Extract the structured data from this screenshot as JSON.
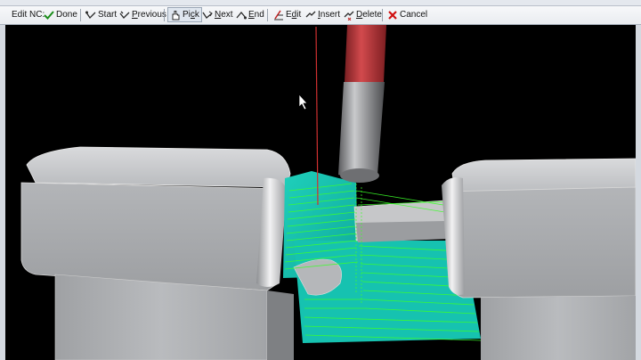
{
  "toolbar": {
    "title": "Edit NC:",
    "buttons": {
      "done": "Done",
      "start": "Start",
      "previous": "Previous",
      "pick": "Pick",
      "next": "Next",
      "end": "End",
      "edit": "Edit",
      "insert": "Insert",
      "delete": "Delete",
      "cancel": "Cancel"
    }
  },
  "colors": {
    "toolbar_bg": "#eceff3",
    "viewport_bg": "#000000",
    "part_gray": "#a9abae",
    "toolpath_green": "#3cff2a",
    "cut_surface_cyan": "#18c7b4",
    "tool_red": "#c0393c",
    "cancel_red": "#d01010"
  },
  "icons": {
    "done": "check-icon",
    "start": "path-start-icon",
    "previous": "path-previous-icon",
    "pick": "pick-hand-icon",
    "next": "path-next-icon",
    "end": "path-end-icon",
    "edit": "edit-icon",
    "insert": "insert-icon",
    "delete": "delete-icon",
    "cancel": "cancel-x-icon"
  }
}
